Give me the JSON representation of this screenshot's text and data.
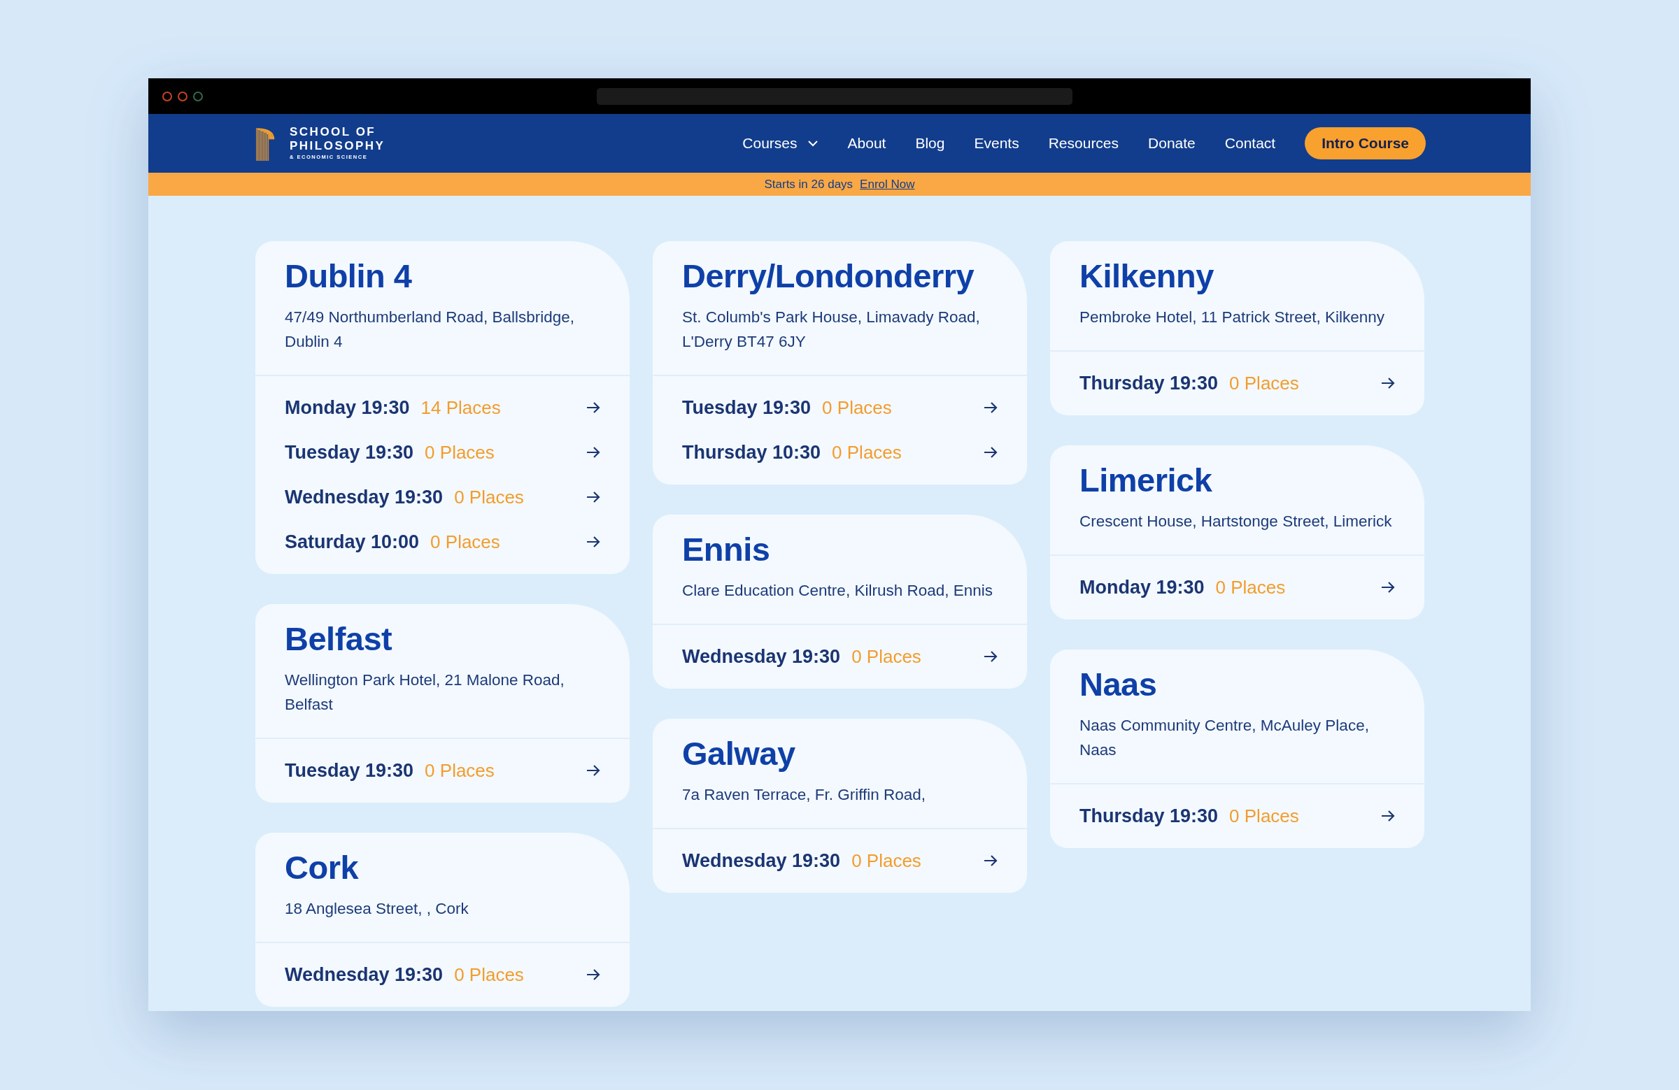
{
  "logo": {
    "lines": [
      "SCHOOL OF",
      "PHILOSOPHY",
      "& ECONOMIC SCIENCE"
    ]
  },
  "nav": {
    "items": [
      {
        "label": "Courses",
        "kind": "dropdown"
      },
      {
        "label": "About",
        "kind": "link"
      },
      {
        "label": "Blog",
        "kind": "link"
      },
      {
        "label": "Events",
        "kind": "link"
      },
      {
        "label": "Resources",
        "kind": "link"
      },
      {
        "label": "Donate",
        "kind": "link"
      },
      {
        "label": "Contact",
        "kind": "link"
      }
    ],
    "cta": "Intro Course"
  },
  "banner": {
    "text": "Starts in 26 days",
    "link": "Enrol Now"
  },
  "columns": [
    {
      "cards": [
        {
          "title": "Dublin 4",
          "address": "47/49 Northumberland Road, Ballsbridge, Dublin 4",
          "sessions": [
            {
              "time": "Monday 19:30",
              "places": "14 Places"
            },
            {
              "time": "Tuesday 19:30",
              "places": "0 Places"
            },
            {
              "time": "Wednesday 19:30",
              "places": "0 Places"
            },
            {
              "time": "Saturday 10:00",
              "places": "0 Places"
            }
          ]
        },
        {
          "title": "Belfast",
          "address": "Wellington Park Hotel, 21 Malone Road, Belfast",
          "sessions": [
            {
              "time": "Tuesday 19:30",
              "places": "0 Places"
            }
          ]
        },
        {
          "title": "Cork",
          "address": "18 Anglesea Street, , Cork",
          "sessions": [
            {
              "time": "Wednesday 19:30",
              "places": "0 Places"
            }
          ]
        }
      ]
    },
    {
      "cards": [
        {
          "title": "Derry/Londonderry",
          "address": "St. Columb's Park House, Limavady Road, L'Derry BT47 6JY",
          "sessions": [
            {
              "time": "Tuesday 19:30",
              "places": "0 Places"
            },
            {
              "time": "Thursday 10:30",
              "places": "0 Places"
            }
          ]
        },
        {
          "title": "Ennis",
          "address": "Clare Education Centre, Kilrush Road, Ennis",
          "sessions": [
            {
              "time": "Wednesday 19:30",
              "places": "0 Places"
            }
          ]
        },
        {
          "title": "Galway",
          "address": "7a Raven Terrace, Fr. Griffin Road,",
          "sessions": [
            {
              "time": "Wednesday 19:30",
              "places": "0 Places"
            }
          ]
        }
      ]
    },
    {
      "cards": [
        {
          "title": "Kilkenny",
          "address": "Pembroke Hotel, 11 Patrick Street, Kilkenny",
          "sessions": [
            {
              "time": "Thursday 19:30",
              "places": "0 Places"
            }
          ]
        },
        {
          "title": "Limerick",
          "address": "Crescent House, Hartstonge Street, Limerick",
          "sessions": [
            {
              "time": "Monday 19:30",
              "places": "0 Places"
            }
          ]
        },
        {
          "title": "Naas",
          "address": "Naas Community Centre, McAuley Place, Naas",
          "sessions": [
            {
              "time": "Thursday 19:30",
              "places": "0 Places"
            }
          ]
        }
      ]
    }
  ]
}
